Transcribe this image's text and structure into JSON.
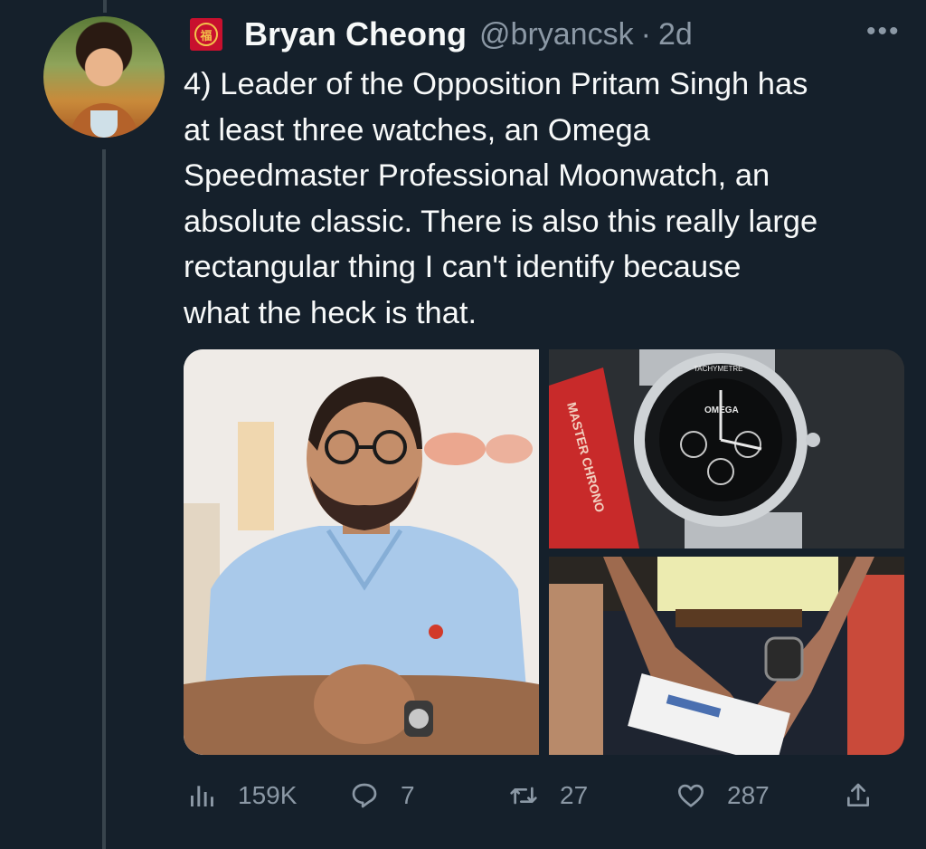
{
  "tweet": {
    "author_name": "Bryan Cheong",
    "handle": "@bryancsk",
    "separator": "·",
    "time": "2d",
    "more_label": "•••",
    "badge_char": "福",
    "text": "4) Leader of the Opposition Pritam Singh has\nat least three watches, an Omega\nSpeedmaster Professional Moonwatch, an\nabsolute classic. There is also this really large\nrectangular thing I can't identify because\nwhat the heck is that."
  },
  "photos": {
    "watch_brand": "OMEGA",
    "bezel_text": "TACHYMETRE",
    "box_text": "MASTER CHRONO"
  },
  "actions": {
    "views": "159K",
    "replies": "7",
    "retweets": "27",
    "likes": "287"
  },
  "icons": {
    "views": "bar-chart-icon",
    "reply": "reply-bubble-icon",
    "retweet": "retweet-icon",
    "like": "heart-icon",
    "share": "share-upload-icon",
    "more": "more-dots-icon"
  },
  "colors": {
    "background": "#15202b",
    "text_primary": "#f7f9f9",
    "text_secondary": "#8b98a5",
    "thread_line": "#38444d"
  }
}
